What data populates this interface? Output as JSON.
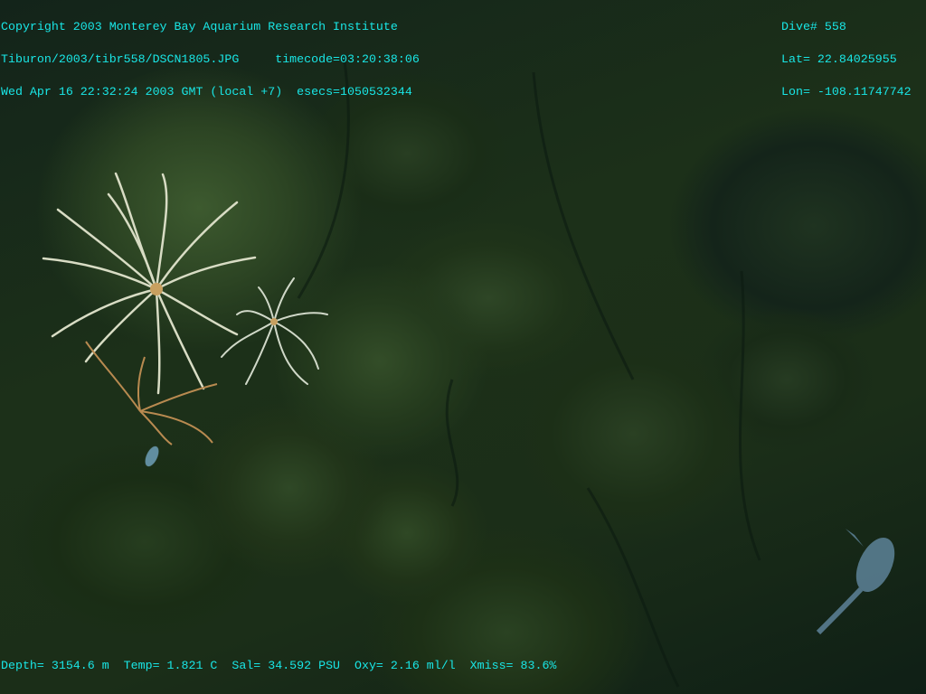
{
  "overlay": {
    "top_left": [
      "Copyright 2003 Monterey Bay Aquarium Research Institute",
      "Tiburon/2003/tibr558/DSCN1805.JPG     timecode=03:20:38:06",
      "Wed Apr 16 22:32:24 2003 GMT (local +7)  esecs=1050532344"
    ],
    "top_right": [
      "Dive# 558",
      "Lat= 22.84025955",
      "Lon= -108.11747742"
    ],
    "bottom": "Depth= 3154.6 m  Temp= 1.821 C  Sal= 34.592 PSU  Oxy= 2.16 ml/l  Xmiss= 83.6%"
  },
  "colors": {
    "overlay_text": "#19e6e6"
  }
}
